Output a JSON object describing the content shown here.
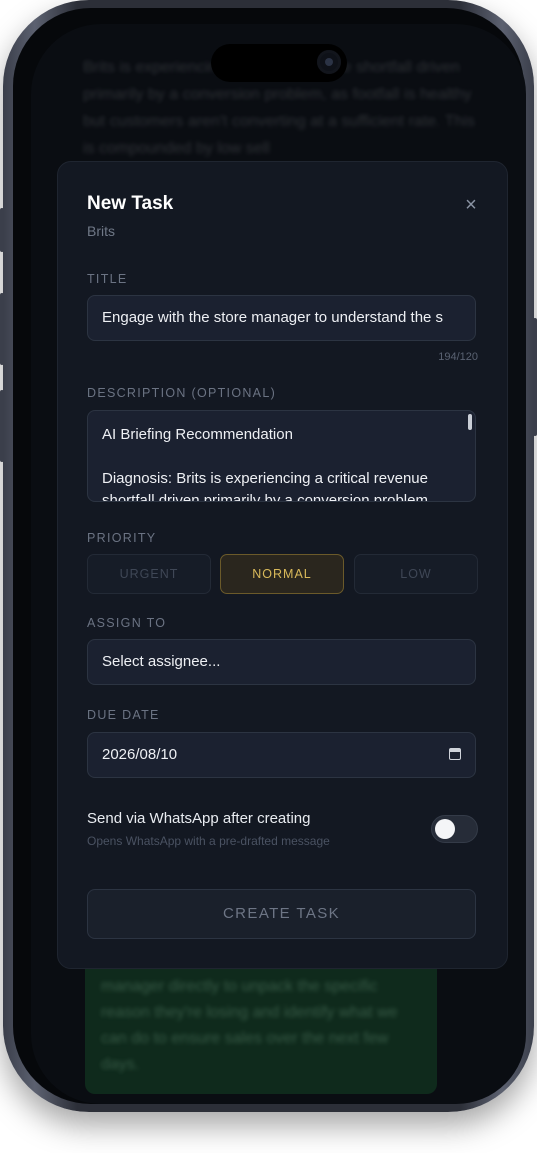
{
  "background": {
    "body_text": "Brits is experiencing a critical revenue shortfall driven primarily by a conversion problem, as footfall is healthy but customers aren't converting at a sufficient rate. This is compounded by low sell",
    "card_text": "manager directly to unpack the specific reason they're losing and identify what we can do to ensure sales over the next few days."
  },
  "modal": {
    "title": "New Task",
    "subtitle": "Brits",
    "close_glyph": "×",
    "title_field": {
      "label": "TITLE",
      "value": "Engage with the store manager to understand the s",
      "counter": "194/120"
    },
    "description_field": {
      "label": "DESCRIPTION (OPTIONAL)",
      "line1": "AI Briefing Recommendation",
      "line2": "Diagnosis: Brits is experiencing a critical revenue shortfall driven primarily by a conversion problem"
    },
    "priority": {
      "label": "PRIORITY",
      "options": [
        "URGENT",
        "NORMAL",
        "LOW"
      ],
      "selected": "NORMAL"
    },
    "assign": {
      "label": "ASSIGN TO",
      "placeholder": "Select assignee..."
    },
    "due_date": {
      "label": "DUE DATE",
      "value": "2026/08/10"
    },
    "whatsapp": {
      "title": "Send via WhatsApp after creating",
      "subtitle": "Opens WhatsApp with a pre-drafted message",
      "enabled": false
    },
    "create_button": "CREATE TASK"
  },
  "colors": {
    "modal_bg": "#131822",
    "field_bg": "#1b2130",
    "accent_selected": "#d9b95a"
  }
}
